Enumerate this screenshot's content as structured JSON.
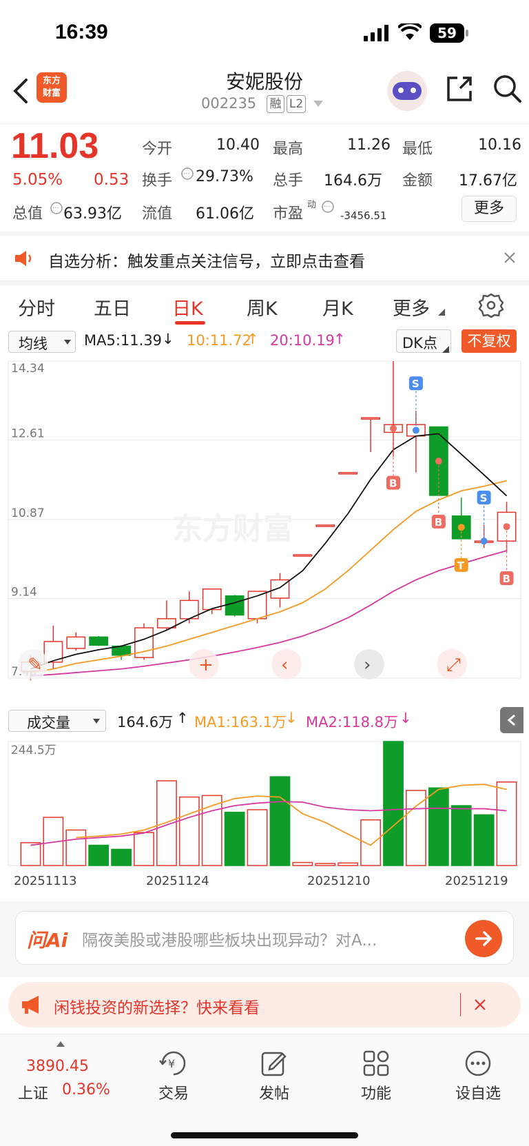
{
  "status": {
    "time": "16:39",
    "battery": "59"
  },
  "nav": {
    "title": "安妮股份",
    "code": "002235",
    "badge_rong": "融",
    "badge_l2": "L2",
    "logo_line1": "东方",
    "logo_line2": "财富"
  },
  "quote": {
    "price": "11.03",
    "pct": "5.05%",
    "change": "0.53",
    "open_label": "今开",
    "open": "10.40",
    "high_label": "最高",
    "high": "11.26",
    "low_label": "最低",
    "low": "10.16",
    "turnover_label": "换手",
    "turnover": "29.73%",
    "volume_label": "总手",
    "volume": "164.6万",
    "amount_label": "金额",
    "amount": "17.67亿",
    "mcap_label": "总值",
    "mcap": "63.93亿",
    "float_label": "流值",
    "float": "61.06亿",
    "pe_label": "市盈",
    "pe_sup": "动",
    "pe": "-3456.51",
    "more": "更多"
  },
  "notice": {
    "text": "自选分析：触发重点关注信号，立即点击查看"
  },
  "tabs": [
    "分时",
    "五日",
    "日K",
    "周K",
    "月K",
    "更多"
  ],
  "chart_data": [
    {
      "type": "candlestick",
      "indicator_select": "均线",
      "ma_labels": {
        "ma5": "MA5:11.39",
        "ma10": "10:11.72",
        "ma20": "20:10.19"
      },
      "dk_label": "DK点",
      "fuquan": "不复权",
      "yticks": [
        "14.34",
        "12.61",
        "10.87",
        "9.14",
        "7.40"
      ],
      "ylim": [
        7.4,
        14.34
      ],
      "candles": [
        {
          "o": 7.55,
          "h": 7.9,
          "l": 7.35,
          "c": 7.75
        },
        {
          "o": 7.75,
          "h": 8.55,
          "l": 7.6,
          "c": 8.2
        },
        {
          "o": 8.05,
          "h": 8.4,
          "l": 8.0,
          "c": 8.3
        },
        {
          "o": 8.3,
          "h": 8.32,
          "l": 8.1,
          "c": 8.12
        },
        {
          "o": 8.1,
          "h": 8.12,
          "l": 7.8,
          "c": 7.9
        },
        {
          "o": 7.85,
          "h": 8.6,
          "l": 7.8,
          "c": 8.5
        },
        {
          "o": 8.5,
          "h": 9.1,
          "l": 8.45,
          "c": 8.7
        },
        {
          "o": 8.7,
          "h": 9.3,
          "l": 8.6,
          "c": 9.1
        },
        {
          "o": 8.9,
          "h": 9.35,
          "l": 8.8,
          "c": 9.35
        },
        {
          "o": 9.2,
          "h": 9.22,
          "l": 8.75,
          "c": 8.78
        },
        {
          "o": 8.7,
          "h": 9.3,
          "l": 8.6,
          "c": 9.3
        },
        {
          "o": 9.15,
          "h": 9.7,
          "l": 8.95,
          "c": 9.55
        },
        {
          "o": 10.1,
          "h": 10.1,
          "l": 10.1,
          "c": 10.1
        },
        {
          "o": 10.75,
          "h": 10.75,
          "l": 10.75,
          "c": 10.75
        },
        {
          "o": 11.9,
          "h": 11.9,
          "l": 11.9,
          "c": 11.9
        },
        {
          "o": 13.1,
          "h": 13.1,
          "l": 12.35,
          "c": 13.1
        },
        {
          "o": 12.78,
          "h": 14.34,
          "l": 12.25,
          "c": 12.95
        },
        {
          "o": 12.7,
          "h": 13.25,
          "l": 11.9,
          "c": 12.95
        },
        {
          "o": 12.9,
          "h": 12.9,
          "l": 11.4,
          "c": 11.4
        },
        {
          "o": 10.95,
          "h": 11.35,
          "l": 10.45,
          "c": 10.45
        },
        {
          "o": 10.4,
          "h": 10.75,
          "l": 10.25,
          "c": 10.4
        },
        {
          "o": 10.4,
          "h": 11.26,
          "l": 10.16,
          "c": 11.03
        }
      ],
      "ma5": [
        7.6,
        7.78,
        7.92,
        8.02,
        8.1,
        8.25,
        8.45,
        8.7,
        8.92,
        9.05,
        9.2,
        9.38,
        9.75,
        10.35,
        11.0,
        11.75,
        12.4,
        12.7,
        12.75,
        12.3,
        11.85,
        11.39
      ],
      "ma10": [
        7.52,
        7.6,
        7.72,
        7.8,
        7.88,
        7.98,
        8.1,
        8.25,
        8.4,
        8.55,
        8.7,
        8.85,
        9.05,
        9.35,
        9.75,
        10.2,
        10.65,
        11.05,
        11.3,
        11.5,
        11.6,
        11.72
      ],
      "ma20": [
        7.45,
        7.48,
        7.52,
        7.56,
        7.6,
        7.66,
        7.73,
        7.8,
        7.88,
        7.97,
        8.07,
        8.18,
        8.32,
        8.5,
        8.72,
        9.0,
        9.3,
        9.55,
        9.75,
        9.9,
        10.05,
        10.19
      ],
      "signals": [
        {
          "i": 16,
          "label": "B",
          "kind": "buy"
        },
        {
          "i": 17,
          "label": "S",
          "kind": "sell"
        },
        {
          "i": 18,
          "label": "B",
          "kind": "buy"
        },
        {
          "i": 19,
          "label": "T",
          "kind": "t"
        },
        {
          "i": 20,
          "label": "S",
          "kind": "sell"
        },
        {
          "i": 21,
          "label": "B",
          "kind": "buy"
        }
      ]
    },
    {
      "type": "bar",
      "indicator_select": "成交量",
      "vol_label": "164.6万",
      "ma1_label": "MA1:163.1万",
      "ma2_label": "MA2:118.8万",
      "ymax_label": "244.5万",
      "ylim": [
        0,
        244.5
      ],
      "x_labels": [
        "20251113",
        "20251124",
        "20251210",
        "20251219"
      ],
      "values": [
        45,
        95,
        70,
        40,
        32,
        65,
        167,
        135,
        138,
        105,
        110,
        175,
        6,
        4,
        5,
        90,
        244.5,
        148,
        153,
        118,
        100,
        164.6
      ],
      "up": [
        true,
        true,
        true,
        false,
        false,
        true,
        true,
        true,
        true,
        false,
        true,
        false,
        true,
        true,
        true,
        true,
        false,
        true,
        false,
        false,
        false,
        true
      ],
      "ma1": [
        null,
        null,
        55,
        58,
        62,
        70,
        85,
        102,
        118,
        132,
        137,
        135,
        102,
        85,
        62,
        40,
        78,
        117,
        150,
        158,
        160,
        150
      ],
      "ma2": [
        40,
        46,
        52,
        55,
        58,
        64,
        80,
        95,
        108,
        118,
        123,
        126,
        125,
        115,
        110,
        108,
        110,
        112,
        113,
        112,
        112,
        108
      ]
    }
  ],
  "ai": {
    "logo": "问Ai",
    "placeholder": "隔夜美股或港股哪些板块出现异动？对A..."
  },
  "ad": {
    "text": "闲钱投资的新选择？快来看看"
  },
  "bottom": {
    "index_value": "3890.45",
    "index_name": "上证",
    "index_pct": "0.36%",
    "items": [
      "交易",
      "发帖",
      "功能",
      "设自选"
    ]
  },
  "colors": {
    "up": "#e4352b",
    "down": "#0e9d29",
    "ma5": "#111111",
    "ma10": "#f59a23",
    "ma20": "#d6389f"
  }
}
